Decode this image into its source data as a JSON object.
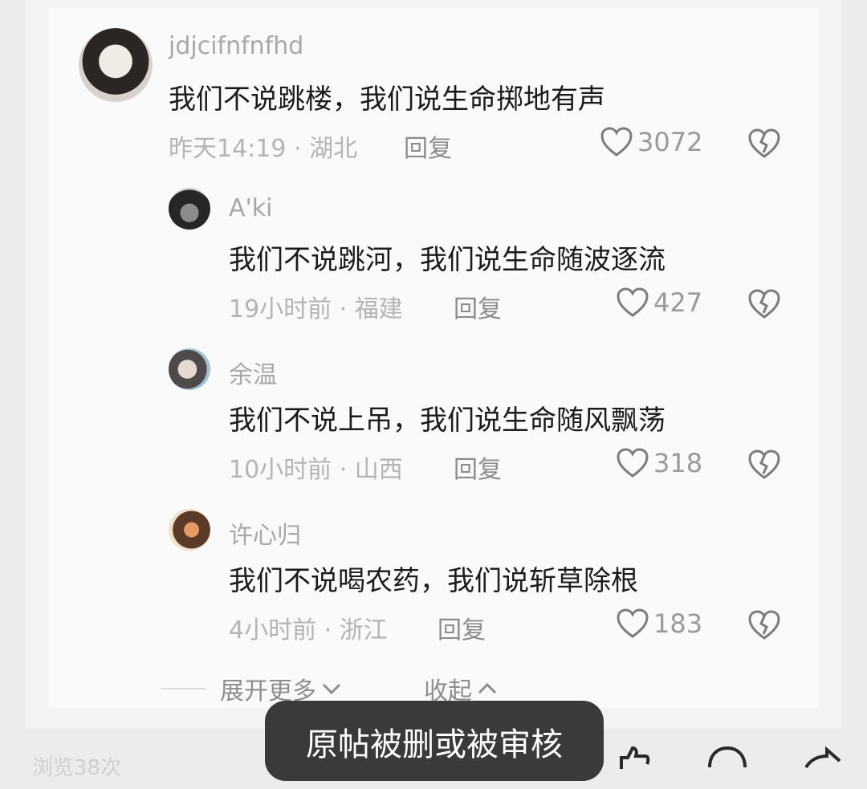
{
  "comments": [
    {
      "username": "jdjcifnfnfhd",
      "content": "我们不说跳楼，我们说生命掷地有声",
      "meta": "昨天14:19 · 湖北",
      "reply": "回复",
      "likes": "3072"
    },
    {
      "username": "A'ki",
      "content": "我们不说跳河，我们说生命随波逐流",
      "meta": "19小时前 · 福建",
      "reply": "回复",
      "likes": "427"
    },
    {
      "username": "余温",
      "content": "我们不说上吊，我们说生命随风飘荡",
      "meta": "10小时前 · 山西",
      "reply": "回复",
      "likes": "318"
    },
    {
      "username": "许心归",
      "content": "我们不说喝农药，我们说斩草除根",
      "meta": "4小时前 · 浙江",
      "reply": "回复",
      "likes": "183"
    }
  ],
  "footer": {
    "expand_label": "展开更多",
    "collapse_label": "收起"
  },
  "toast": "原帖被删或被审核",
  "bottom_bar": {
    "views_text": "浏览38次"
  },
  "icons": [
    "heart-icon",
    "broken-heart-icon",
    "chevron-down-icon",
    "chevron-up-icon",
    "like-icon",
    "comment-icon",
    "share-icon"
  ],
  "colors": {
    "background": "#ececec",
    "card": "#fafafa",
    "text": "#1b1b1b",
    "muted": "#a8a8a8",
    "toast": "#3a3a3a"
  }
}
